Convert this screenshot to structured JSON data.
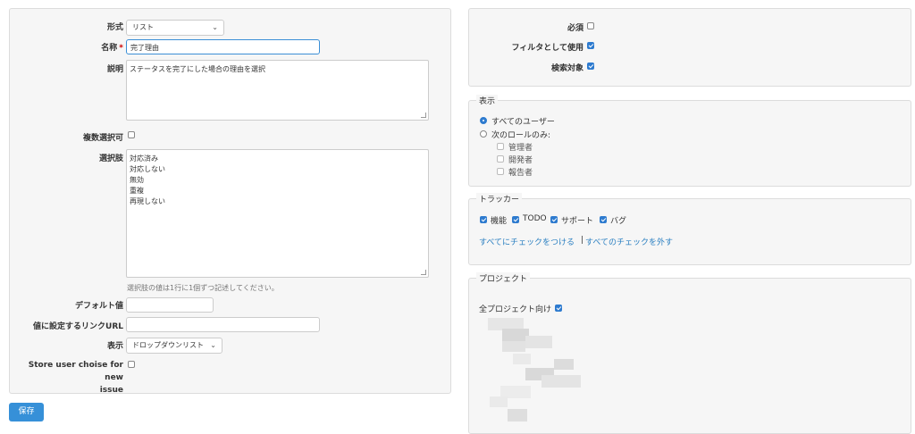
{
  "left_form": {
    "format": {
      "label": "形式",
      "value": "リスト"
    },
    "name": {
      "label": "名称",
      "required_mark": "*",
      "value": "完了理由"
    },
    "description": {
      "label": "説明",
      "value": "ステータスを完了にした場合の理由を選択"
    },
    "multiple": {
      "label": "複数選択可",
      "checked": false
    },
    "possible_values": {
      "label": "選択肢",
      "values": [
        "対応済み",
        "対応しない",
        "無効",
        "重複",
        "再現しない"
      ],
      "hint": "選択肢の値は1行に1個ずつ記述してください。"
    },
    "default_value": {
      "label": "デフォルト値",
      "value": ""
    },
    "url": {
      "label": "値に設定するリンクURL",
      "value": ""
    },
    "display": {
      "label": "表示",
      "value": "ドロップダウンリスト"
    },
    "store_user": {
      "label_line1": "Store user choise for new",
      "label_line2": "issue",
      "checked": false
    }
  },
  "save_button": "保存",
  "right_top": {
    "required": {
      "label": "必須",
      "checked": false
    },
    "filter": {
      "label": "フィルタとして使用",
      "checked": true
    },
    "searchable": {
      "label": "検索対象",
      "checked": true
    }
  },
  "visibility": {
    "legend": "表示",
    "all_users": "すべてのユーザー",
    "roles_only": "次のロールのみ:",
    "roles": [
      "管理者",
      "開発者",
      "報告者"
    ],
    "selected": "all_users"
  },
  "trackers": {
    "legend": "トラッカー",
    "items": [
      {
        "label": "機能",
        "checked": true
      },
      {
        "label": "TODO",
        "checked": true
      },
      {
        "label": "サポート",
        "checked": true
      },
      {
        "label": "バグ",
        "checked": true
      }
    ],
    "check_all": "すべてにチェックをつける",
    "separator": "|",
    "uncheck_all": "すべてのチェックを外す"
  },
  "projects": {
    "legend": "プロジェクト",
    "for_all_label": "全プロジェクト向け",
    "for_all_checked": true
  },
  "colors": {
    "accent": "#2e7bcf",
    "link": "#2a7fc1",
    "button": "#3690d8",
    "required": "#cc0000"
  }
}
